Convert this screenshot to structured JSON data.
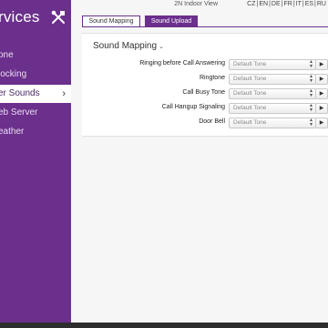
{
  "sidebar": {
    "title": "rvices",
    "tools_icon": "tools-icon",
    "items": [
      {
        "label": "one"
      },
      {
        "label": "locking"
      },
      {
        "label": "er Sounds",
        "active": true
      },
      {
        "label": "eb Server"
      },
      {
        "label": "eather"
      }
    ],
    "active_chevron": "›"
  },
  "topbar": {
    "view_label": "2N Indoor View",
    "languages": [
      "CZ",
      "EN",
      "DE",
      "FR",
      "IT",
      "ES",
      "RU"
    ]
  },
  "tabs": [
    {
      "label": "Sound Mapping",
      "active": true
    },
    {
      "label": "Sound Upload",
      "active": false
    }
  ],
  "section": {
    "title": "Sound Mapping",
    "caret": "⌄"
  },
  "rows": [
    {
      "label": "Ringing before Call Answering",
      "value": "Default Tone",
      "play": "▶"
    },
    {
      "label": "Ringtone",
      "value": "Default Tone",
      "play": "▶"
    },
    {
      "label": "Call Busy Tone",
      "value": "Default Tone",
      "play": "▶"
    },
    {
      "label": "Call Hangup Signaling",
      "value": "Default Tone",
      "play": "▶"
    },
    {
      "label": "Door Bell",
      "value": "Default Tone",
      "play": "▶"
    }
  ],
  "colors": {
    "accent": "#6b2f8c",
    "background": "#f6f6f6"
  }
}
